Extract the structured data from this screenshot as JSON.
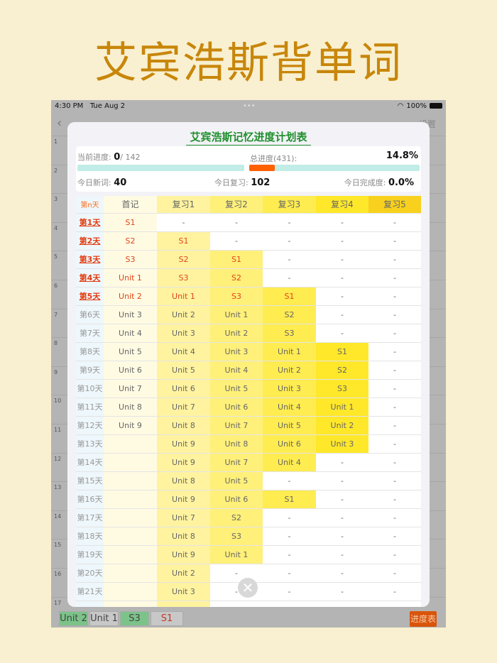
{
  "hero_title": "艾宾浩斯背单词",
  "status": {
    "time": "4:30 PM",
    "date": "Tue Aug 2",
    "battery": "100%"
  },
  "background": {
    "setting": "设置",
    "row_numbers": [
      "1",
      "2",
      "3",
      "4",
      "5",
      "6",
      "7",
      "8",
      "9",
      "10",
      "11",
      "12",
      "13",
      "14",
      "15",
      "16",
      "17"
    ]
  },
  "modal": {
    "title": "艾宾浩斯记忆进度计划表",
    "current_label": "当前进度:",
    "current_value": "0",
    "current_total": "/ 142",
    "total_label": "总进度(431):",
    "total_percent": "14.8%",
    "total_progress": 0.148,
    "new_label": "今日新词:",
    "new_value": "40",
    "review_label": "今日复习:",
    "review_value": "102",
    "done_label": "今日完成度:",
    "done_value": "0.0%",
    "close_icon": "close-icon"
  },
  "table": {
    "headers": [
      "第n天",
      "首记",
      "复习1",
      "复习2",
      "复习3",
      "复习4",
      "复习5"
    ],
    "header_colors": [
      "#eef7fb",
      "#fffbe3",
      "#fff3a0",
      "#fff07a",
      "#ffec50",
      "#ffe82a",
      "#f7d11e"
    ],
    "rows": [
      [
        "第1天",
        "S1",
        "-",
        "-",
        "-",
        "-",
        "-"
      ],
      [
        "第2天",
        "S2",
        "S1",
        "-",
        "-",
        "-",
        "-"
      ],
      [
        "第3天",
        "S3",
        "S2",
        "S1",
        "-",
        "-",
        "-"
      ],
      [
        "第4天",
        "Unit 1",
        "S3",
        "S2",
        "-",
        "-",
        "-"
      ],
      [
        "第5天",
        "Unit 2",
        "Unit 1",
        "S3",
        "S1",
        "-",
        "-"
      ],
      [
        "第6天",
        "Unit 3",
        "Unit 2",
        "Unit 1",
        "S2",
        "-",
        "-"
      ],
      [
        "第7天",
        "Unit 4",
        "Unit 3",
        "Unit 2",
        "S3",
        "-",
        "-"
      ],
      [
        "第8天",
        "Unit 5",
        "Unit 4",
        "Unit 3",
        "Unit 1",
        "S1",
        "-"
      ],
      [
        "第9天",
        "Unit 6",
        "Unit 5",
        "Unit 4",
        "Unit 2",
        "S2",
        "-"
      ],
      [
        "第10天",
        "Unit 7",
        "Unit 6",
        "Unit 5",
        "Unit 3",
        "S3",
        "-"
      ],
      [
        "第11天",
        "Unit 8",
        "Unit 7",
        "Unit 6",
        "Unit 4",
        "Unit 1",
        "-"
      ],
      [
        "第12天",
        "Unit 9",
        "Unit 8",
        "Unit 7",
        "Unit 5",
        "Unit 2",
        "-"
      ],
      [
        "第13天",
        "",
        "Unit 9",
        "Unit 8",
        "Unit 6",
        "Unit 3",
        "-"
      ],
      [
        "第14天",
        "",
        "Unit 9",
        "Unit 7",
        "Unit 4",
        "-",
        "-"
      ],
      [
        "第15天",
        "",
        "Unit 8",
        "Unit 5",
        "-",
        "-",
        "-"
      ],
      [
        "第16天",
        "",
        "Unit 9",
        "Unit 6",
        "S1",
        "-",
        "-"
      ],
      [
        "第17天",
        "",
        "Unit 7",
        "S2",
        "-",
        "-",
        "-"
      ],
      [
        "第18天",
        "",
        "Unit 8",
        "S3",
        "-",
        "-",
        "-"
      ],
      [
        "第19天",
        "",
        "Unit 9",
        "Unit 1",
        "-",
        "-",
        "-"
      ],
      [
        "第20天",
        "",
        "Unit 2",
        "-",
        "-",
        "-",
        "-"
      ],
      [
        "第21天",
        "",
        "Unit 3",
        "-",
        "-",
        "-",
        "-"
      ],
      [
        "",
        "",
        "",
        "",
        "",
        "",
        ""
      ]
    ]
  },
  "bottom_tabs": [
    {
      "label": "Unit 2",
      "color": "#7cc38a"
    },
    {
      "label": "Unit 1",
      "color": "#c8c8c8"
    },
    {
      "label": "S3",
      "color": "#7cc38a"
    },
    {
      "label": "S1",
      "color": "#c8c8c8"
    }
  ],
  "progress_button": "进度表"
}
